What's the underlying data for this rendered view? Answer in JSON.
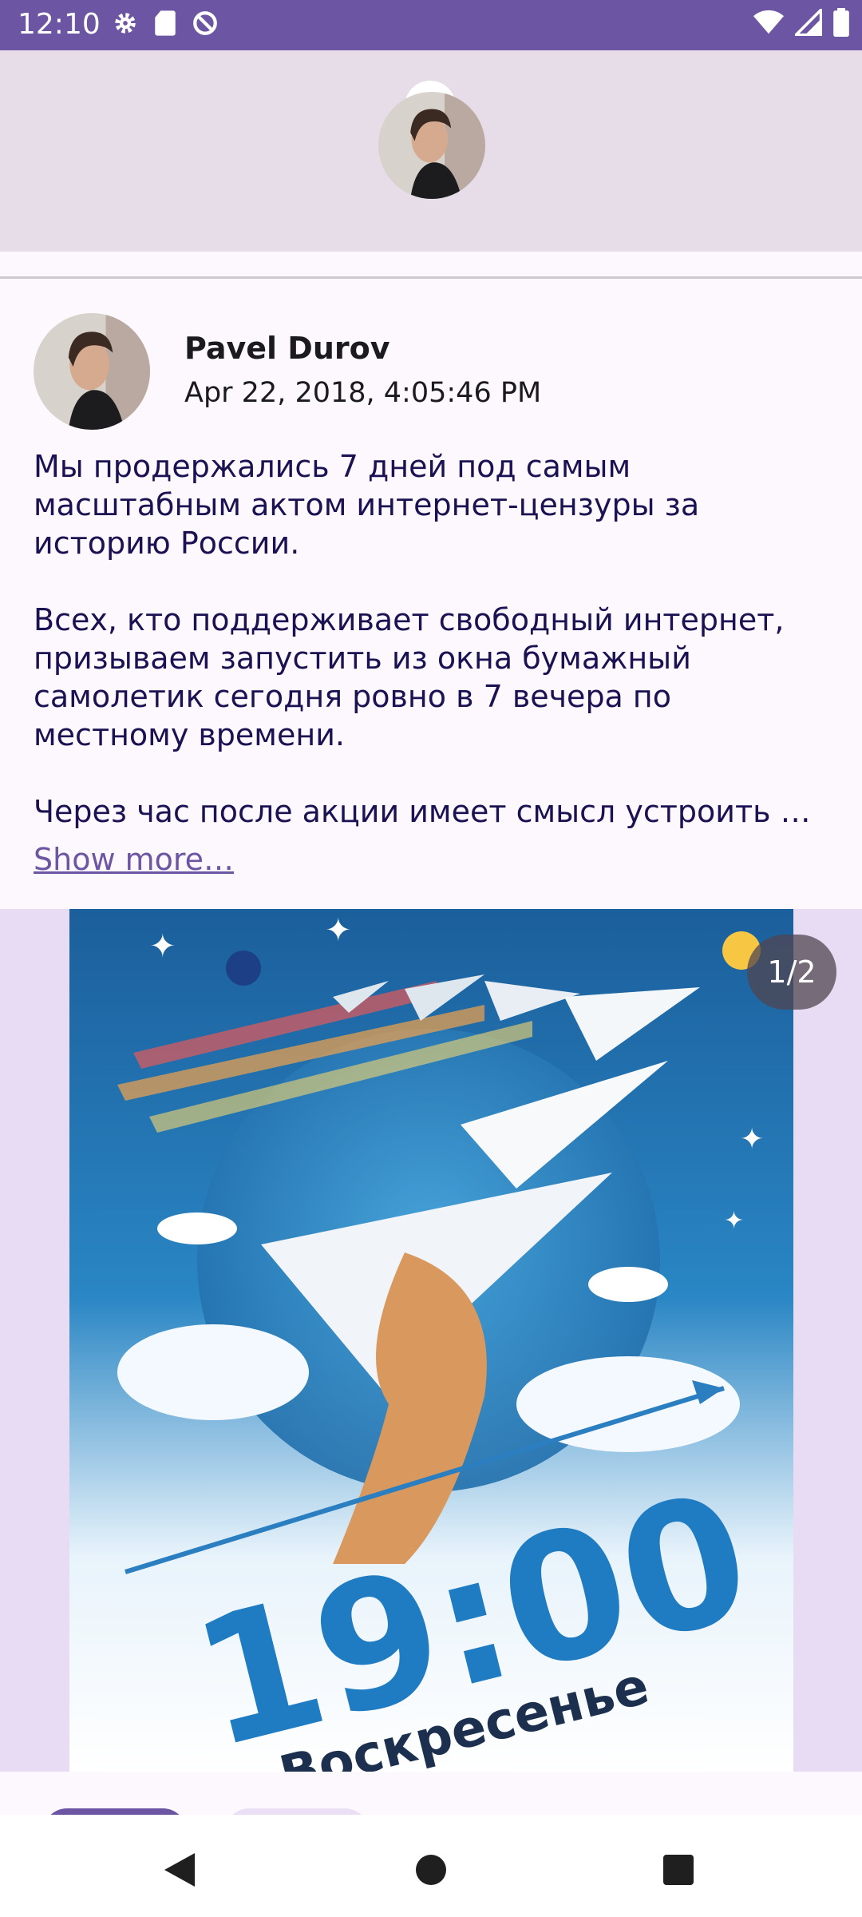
{
  "status_bar": {
    "time": "12:10",
    "left_icons": [
      "gear-icon",
      "sd-card-icon",
      "no-sync-icon"
    ],
    "right_icons": [
      "wifi-icon",
      "signal-icon",
      "battery-icon"
    ],
    "background": "#6c55a3"
  },
  "header": {
    "avatar": "channel-avatar"
  },
  "post": {
    "author": "Pavel Durov",
    "date": "Apr 22, 2018, 4:05:46 PM",
    "paragraphs": [
      "Мы продержались 7 дней под самым масштабным актом интернет-цензуры за историю России.",
      "Всех, кто поддерживает свободный интернет, призываем запустить из окна бумажный самолетик сегодня ровно в 7 вечера по местному времени.",
      "Через час после акции имеет смысл устроить …"
    ],
    "show_more": "Show more…"
  },
  "media": {
    "counter": "1/2",
    "image_text_time": "19:00",
    "image_text_day": "Воскресенье"
  },
  "colors": {
    "accent": "#6c55a3",
    "text": "#1a1253",
    "header_bg": "#e6dde8",
    "media_bg": "#e7dcf3"
  }
}
